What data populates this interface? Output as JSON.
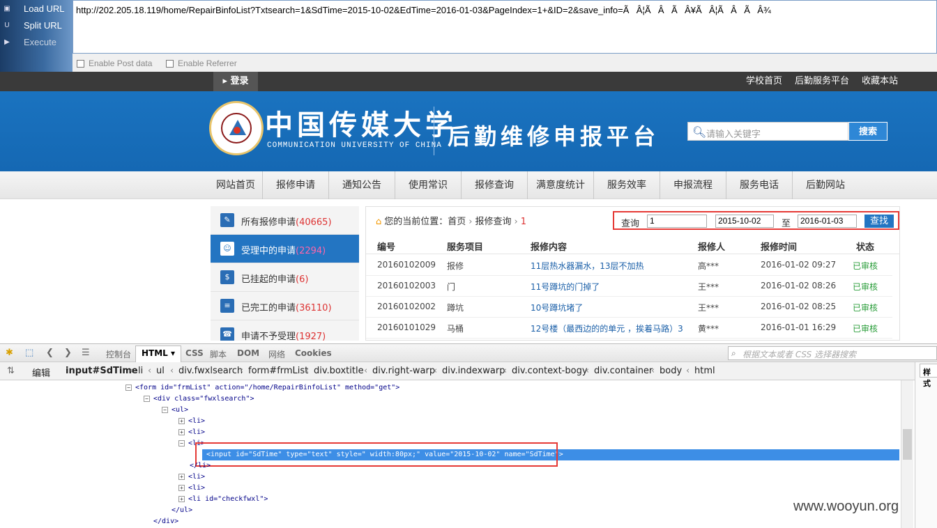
{
  "hackbar": {
    "load_url": "Load URL",
    "split_url": "Split URL",
    "execute": "Execute",
    "url": "http://202.205.18.119/home/RepairBinfoList?Txtsearch=1&SdTime=2015-10-02&EdTime=2016-01-03&PageIndex=1+&ID=2&save_info=ÃÂ¦ÃÂÃÂ¥ÃÂ¦ÃÂÃÂ¾",
    "enable_post": "Enable Post data",
    "enable_referrer": "Enable Referrer"
  },
  "site": {
    "login": "登录",
    "top_links": [
      "学校首页",
      "后勤服务平台",
      "收藏本站"
    ],
    "cn_name": "中国传媒大学",
    "en_name": "COMMUNICATION UNIVERSITY OF CHINA",
    "platform_title": "后勤维修申报平台",
    "search_placeholder": "请输入关键字",
    "search_button": "搜索",
    "nav": [
      "网站首页",
      "报修申请",
      "通知公告",
      "使用常识",
      "报修查询",
      "满意度统计",
      "服务效率",
      "申报流程",
      "服务电话",
      "后勤网站"
    ],
    "sidebar": [
      {
        "label": "所有报修申请",
        "count": "(40665)",
        "icon": "edit-icon"
      },
      {
        "label": "受理中的申请",
        "count": "(2294)",
        "icon": "user-card-icon"
      },
      {
        "label": "已挂起的申请",
        "count": "(6)",
        "icon": "money-list-icon"
      },
      {
        "label": "已完工的申请",
        "count": "(36110)",
        "icon": "book-icon"
      },
      {
        "label": "申请不予受理",
        "count": "(1927)",
        "icon": "phone-icon"
      }
    ],
    "breadcrumb": {
      "label": "您的当前位置：",
      "home": "首页",
      "section": "报修查询",
      "current": "1"
    },
    "query": {
      "label": "查询",
      "keyword": "1",
      "start": "2015-10-02",
      "to": "至",
      "end": "2016-01-03",
      "button": "查找"
    },
    "table": {
      "headers": [
        "编号",
        "服务项目",
        "报修内容",
        "报修人",
        "报修时间",
        "状态"
      ],
      "rows": [
        [
          "20160102009",
          "报修",
          "11层热水器漏水，13层不加热",
          "高***",
          "2016-01-02 09:27",
          "已审核"
        ],
        [
          "20160102003",
          "门",
          "11号蹲坑的门掉了",
          "王***",
          "2016-01-02 08:26",
          "已审核"
        ],
        [
          "20160102002",
          "蹲坑",
          "10号蹲坑堵了",
          "王***",
          "2016-01-02 08:25",
          "已审核"
        ],
        [
          "20160101029",
          "马桶",
          "12号楼（最西边的的单元 ，挨着马路）3",
          "黄***",
          "2016-01-01 16:29",
          "已审核"
        ]
      ]
    }
  },
  "firebug": {
    "tabs": [
      "控制台",
      "HTML",
      "CSS",
      "脚本",
      "DOM",
      "网络",
      "Cookies"
    ],
    "search_placeholder": "根据文本或者 CSS 选择器搜索",
    "edit": "编辑",
    "breadcrumbs": [
      "input#SdTime",
      "li",
      "ul",
      "div.fwxlsearch",
      "form#frmList",
      "div.boxtitle",
      "div.right-warp",
      "div.indexwarp",
      "div.context-bogy",
      "div.container",
      "body",
      "html"
    ],
    "side_tab": "样式",
    "tree": {
      "form_line": "<form id=\"frmList\" action=\"/home/RepairBinfoList\" method=\"get\">",
      "div_line": "<div class=\"fwxlsearch\">",
      "ul": "<ul>",
      "li": "<li>",
      "li_close": "</li>",
      "selected": "<input id=\"SdTime\" type=\"text\" style=\" width:80px;\" value=\"2015-10-02\" name=\"SdTime\">",
      "li_check": "<li id=\"checkfwxl\">",
      "ul_close": "</ul>",
      "div_close": "</div>"
    }
  },
  "watermark": "www.wooyun.org"
}
